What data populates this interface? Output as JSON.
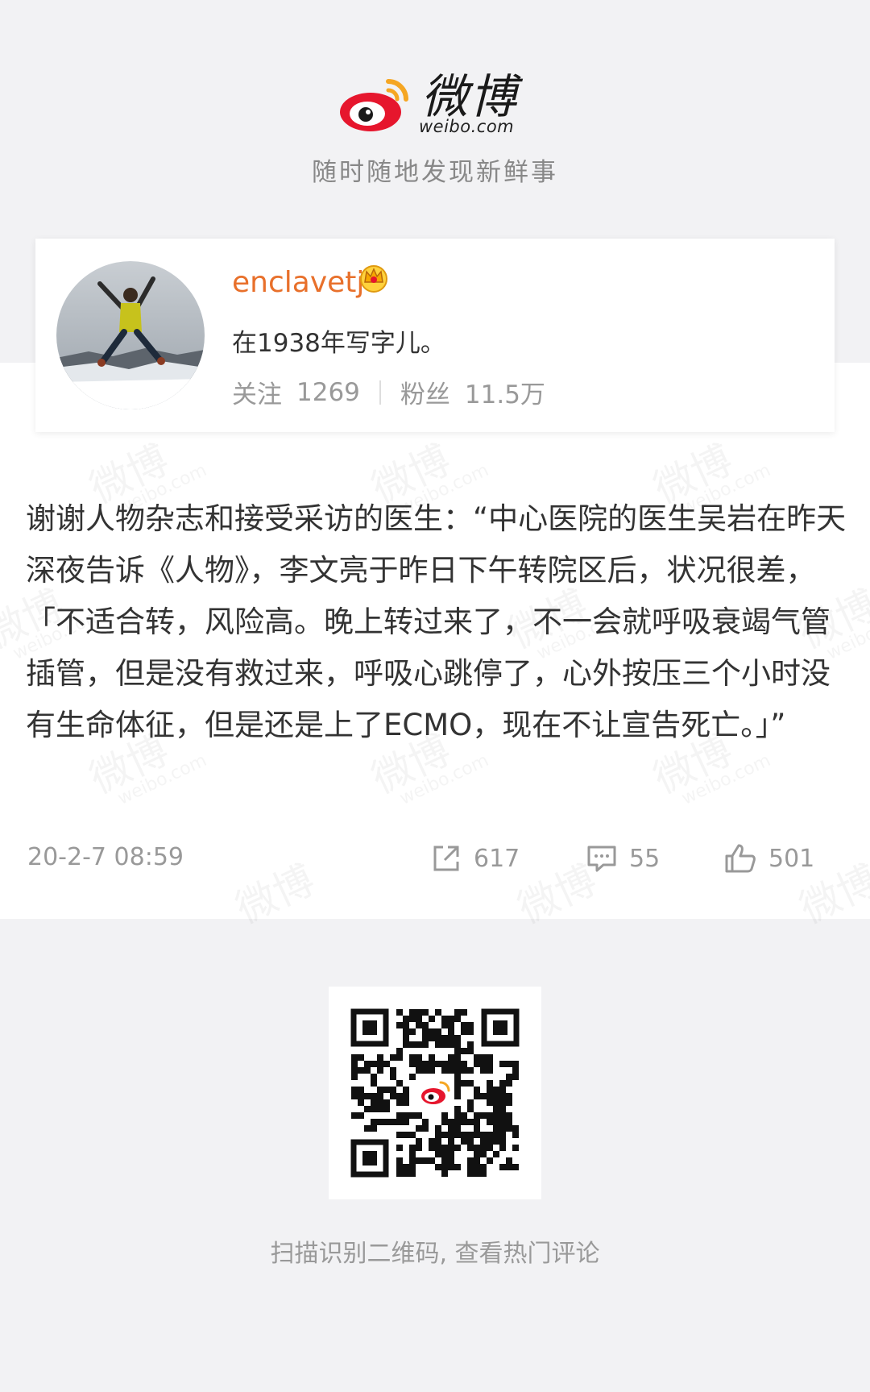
{
  "brand": {
    "logo_text": "微博",
    "logo_sub": "weibo.com",
    "tagline": "随时随地发现新鲜事",
    "accent_color": "#e6162d"
  },
  "profile": {
    "username": "enclavetj",
    "badge_icon": "crown-icon",
    "bio": "在1938年写字儿。",
    "following_label": "关注",
    "following_count": "1269",
    "followers_label": "粉丝",
    "followers_count": "11.5万",
    "username_color": "#e8702b"
  },
  "post": {
    "text": "谢谢人物杂志和接受采访的医生：“中心医院的医生吴岩在昨天深夜告诉《人物》，李文亮于昨日下午转院区后，状况很差，「不适合转，风险高。晚上转过来了，不一会就呼吸衰竭气管插管，但是没有救过来，呼吸心跳停了，心外按压三个小时没有生命体征，但是还是上了ECMO，现在不让宣告死亡。」”",
    "time": "20-2-7 08:59",
    "reposts": "617",
    "comments": "55",
    "likes": "501"
  },
  "footer": {
    "qr_caption": "扫描识别二维码, 查看热门评论"
  }
}
